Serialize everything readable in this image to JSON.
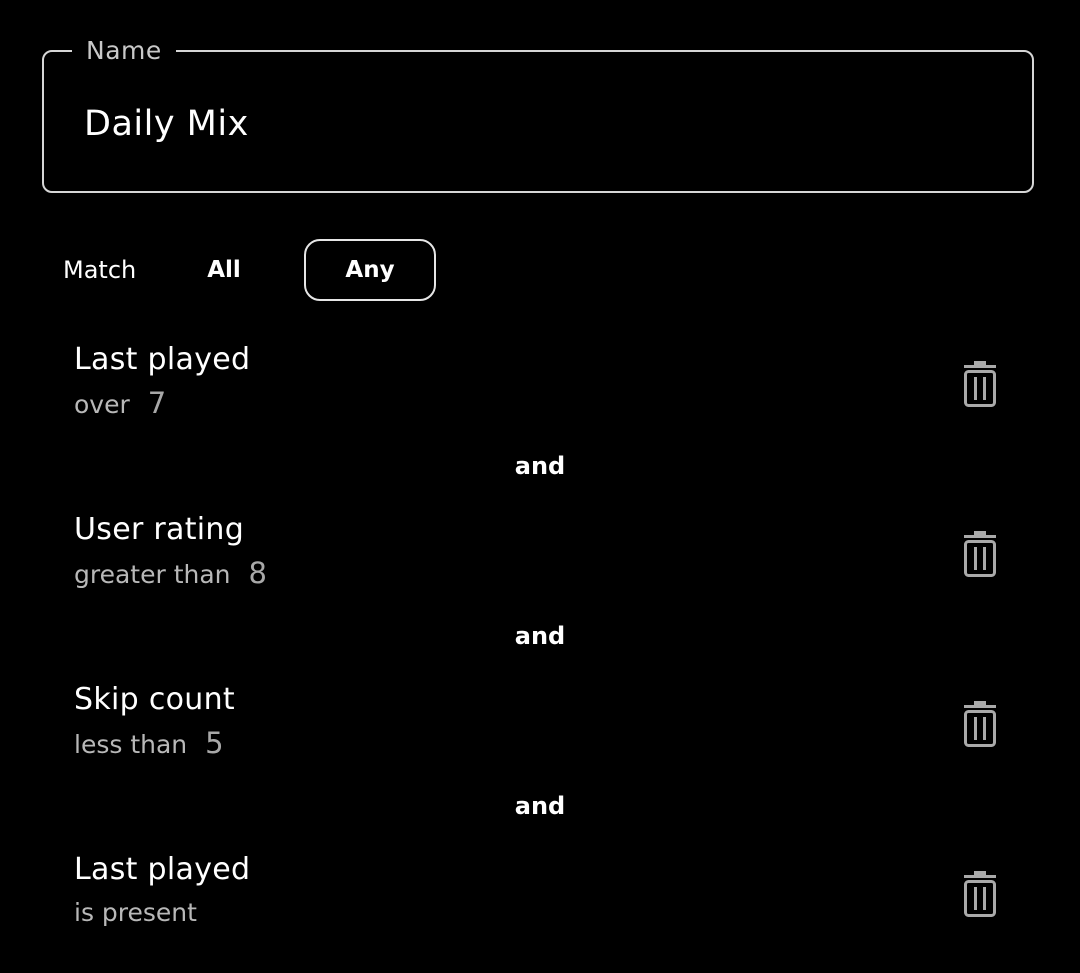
{
  "name_field": {
    "label": "Name",
    "value": "Daily Mix"
  },
  "match": {
    "label": "Match",
    "options": [
      "All",
      "Any"
    ],
    "selected": "Any"
  },
  "rules": [
    {
      "field": "Last played",
      "operator": "over",
      "value": "7"
    },
    {
      "field": "User rating",
      "operator": "greater than",
      "value": "8"
    },
    {
      "field": "Skip count",
      "operator": "less than",
      "value": "5"
    },
    {
      "field": "Last played",
      "operator": "is present",
      "value": ""
    }
  ],
  "connector": "and",
  "icons": {
    "delete": "trash-icon"
  },
  "colors": {
    "background": "#000000",
    "text": "#ffffff",
    "secondary_text": "#b8b8b8",
    "border": "#d6d6d6"
  }
}
